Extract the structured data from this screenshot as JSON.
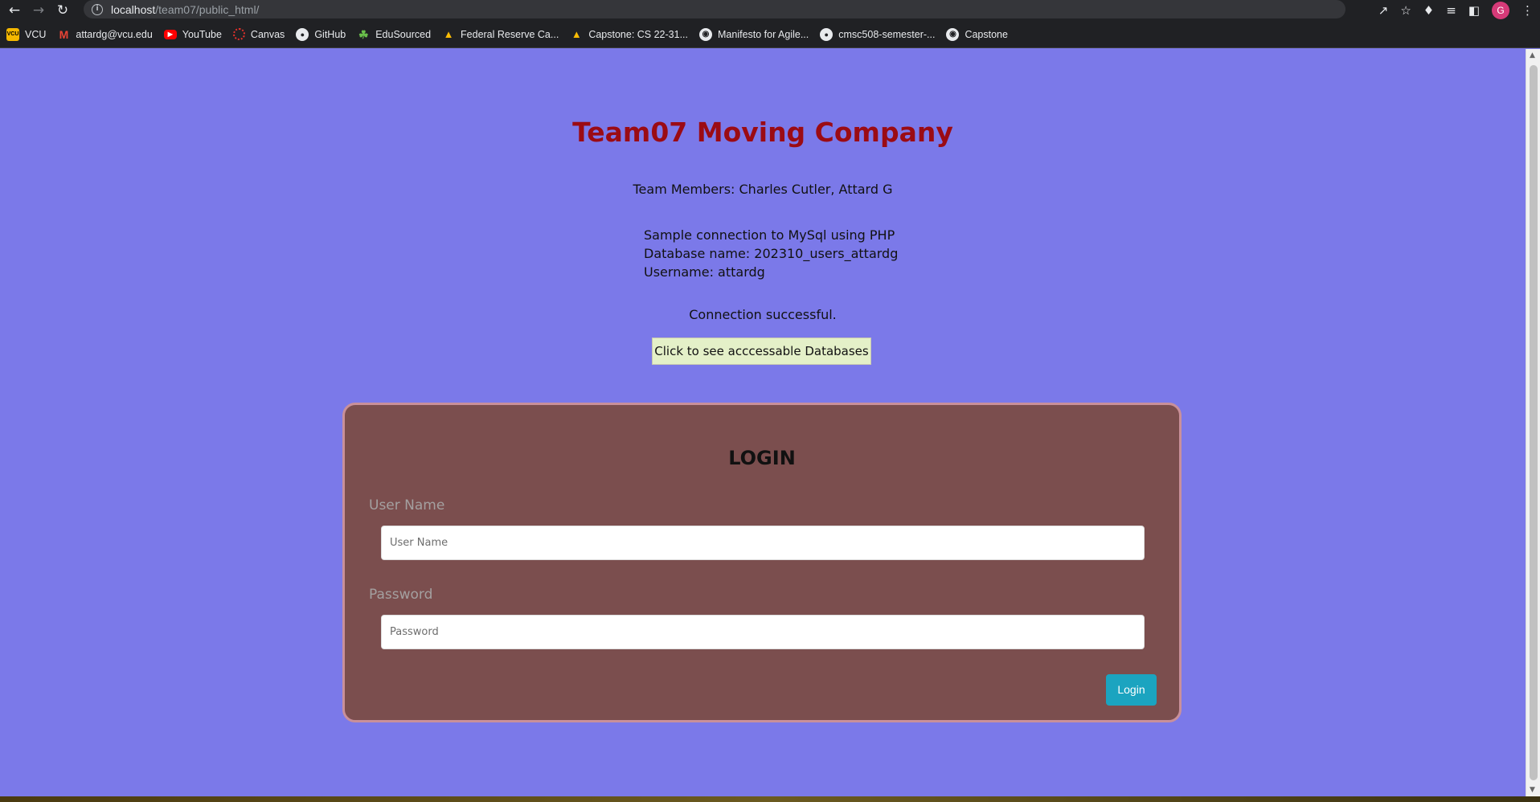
{
  "browser": {
    "url_host": "localhost",
    "url_path": "/team07/public_html/",
    "avatar_letter": "G",
    "bookmarks": [
      {
        "label": "VCU",
        "icon": "vcu-icon"
      },
      {
        "label": "attardg@vcu.edu",
        "icon": "gmail-icon"
      },
      {
        "label": "YouTube",
        "icon": "youtube-icon"
      },
      {
        "label": "Canvas",
        "icon": "canvas-icon"
      },
      {
        "label": "GitHub",
        "icon": "github-icon"
      },
      {
        "label": "EduSourced",
        "icon": "edusourced-icon"
      },
      {
        "label": "Federal Reserve Ca...",
        "icon": "google-drive-icon"
      },
      {
        "label": "Capstone: CS 22-31...",
        "icon": "google-drive-icon"
      },
      {
        "label": "Manifesto for Agile...",
        "icon": "globe-icon"
      },
      {
        "label": "cmsc508-semester-...",
        "icon": "github-icon"
      },
      {
        "label": "Capstone",
        "icon": "globe-icon"
      }
    ]
  },
  "page": {
    "title": "Team07 Moving Company",
    "members": "Team Members: Charles Cutler, Attard G",
    "sample_line1": "Sample connection to MySql using PHP",
    "sample_line2": "Database name: 202310_users_attardg",
    "sample_line3": "Username: attardg",
    "status": "Connection successful.",
    "db_button_label": "Click to see acccessable Databases"
  },
  "login": {
    "heading": "LOGIN",
    "username_label": "User Name",
    "username_placeholder": "User Name",
    "password_label": "Password",
    "password_placeholder": "Password",
    "submit_label": "Login"
  },
  "colors": {
    "page_background": "#7b79e9",
    "title": "#9b0b14",
    "card_background": "#7b4e4e",
    "card_border": "#c9909a",
    "db_button_background": "#e4f0c8",
    "login_button": "#1ba4c0"
  }
}
